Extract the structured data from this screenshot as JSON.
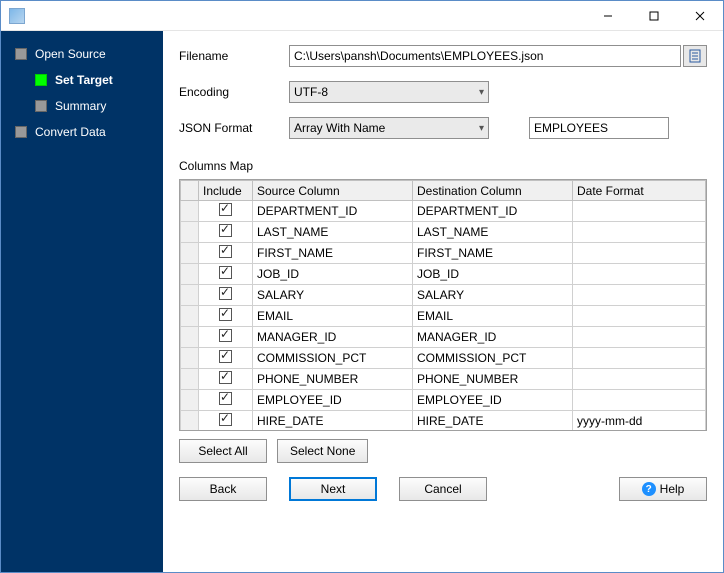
{
  "titlebar": {
    "title": ""
  },
  "sidebar": {
    "items": [
      {
        "label": "Open Source",
        "sub": false,
        "active": false
      },
      {
        "label": "Set Target",
        "sub": true,
        "active": true
      },
      {
        "label": "Summary",
        "sub": true,
        "active": false
      },
      {
        "label": "Convert Data",
        "sub": false,
        "active": false
      }
    ]
  },
  "form": {
    "filename_label": "Filename",
    "filename_value": "C:\\Users\\pansh\\Documents\\EMPLOYEES.json",
    "encoding_label": "Encoding",
    "encoding_value": "UTF-8",
    "json_format_label": "JSON Format",
    "json_format_value": "Array With Name",
    "json_name_value": "EMPLOYEES"
  },
  "columns_map": {
    "label": "Columns Map",
    "headers": {
      "include": "Include",
      "source": "Source Column",
      "dest": "Destination Column",
      "date": "Date Format"
    },
    "rows": [
      {
        "include": true,
        "source": "DEPARTMENT_ID",
        "dest": "DEPARTMENT_ID",
        "date": ""
      },
      {
        "include": true,
        "source": "LAST_NAME",
        "dest": "LAST_NAME",
        "date": ""
      },
      {
        "include": true,
        "source": "FIRST_NAME",
        "dest": "FIRST_NAME",
        "date": ""
      },
      {
        "include": true,
        "source": "JOB_ID",
        "dest": "JOB_ID",
        "date": ""
      },
      {
        "include": true,
        "source": "SALARY",
        "dest": "SALARY",
        "date": ""
      },
      {
        "include": true,
        "source": "EMAIL",
        "dest": "EMAIL",
        "date": ""
      },
      {
        "include": true,
        "source": "MANAGER_ID",
        "dest": "MANAGER_ID",
        "date": ""
      },
      {
        "include": true,
        "source": "COMMISSION_PCT",
        "dest": "COMMISSION_PCT",
        "date": ""
      },
      {
        "include": true,
        "source": "PHONE_NUMBER",
        "dest": "PHONE_NUMBER",
        "date": ""
      },
      {
        "include": true,
        "source": "EMPLOYEE_ID",
        "dest": "EMPLOYEE_ID",
        "date": ""
      },
      {
        "include": true,
        "source": "HIRE_DATE",
        "dest": "HIRE_DATE",
        "date": "yyyy-mm-dd"
      }
    ]
  },
  "buttons": {
    "select_all": "Select All",
    "select_none": "Select None",
    "back": "Back",
    "next": "Next",
    "cancel": "Cancel",
    "help": "Help"
  }
}
